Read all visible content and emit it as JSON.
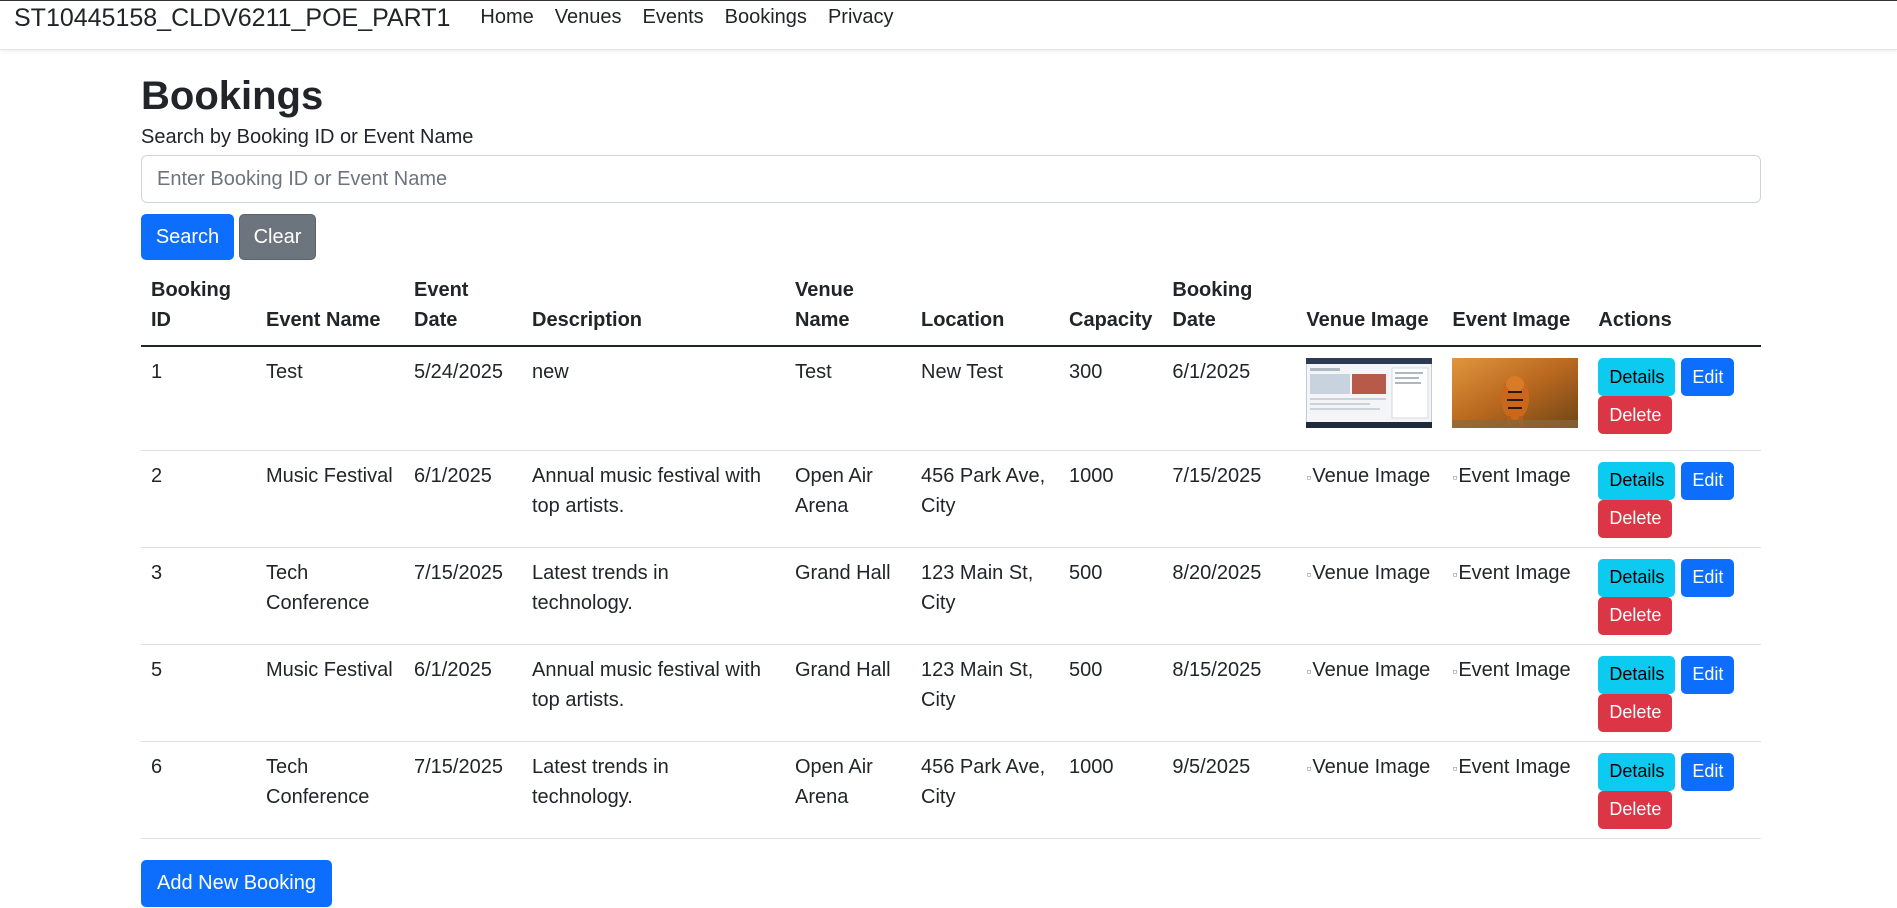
{
  "nav": {
    "brand": "ST10445158_CLDV6211_POE_PART1",
    "links": [
      "Home",
      "Venues",
      "Events",
      "Bookings",
      "Privacy"
    ]
  },
  "page": {
    "title": "Bookings",
    "search_label": "Search by Booking ID or Event Name",
    "search_placeholder": "Enter Booking ID or Event Name",
    "search_button": "Search",
    "clear_button": "Clear",
    "add_button": "Add New Booking"
  },
  "table": {
    "headers": {
      "booking_id": "Booking ID",
      "event_name": "Event Name",
      "event_date": "Event Date",
      "description": "Description",
      "venue_name": "Venue Name",
      "location": "Location",
      "capacity": "Capacity",
      "booking_date": "Booking Date",
      "venue_image": "Venue Image",
      "event_image": "Event Image",
      "actions": "Actions"
    },
    "actions": {
      "details": "Details",
      "edit": "Edit",
      "delete": "Delete"
    },
    "alt": {
      "venue": "Venue Image",
      "event": "Event Image"
    },
    "rows": [
      {
        "id": "1",
        "event": "Test",
        "event_date": "5/24/2025",
        "description": "new",
        "venue": "Test",
        "location": "New Test",
        "capacity": "300",
        "booking_date": "6/1/2025",
        "has_images": true
      },
      {
        "id": "2",
        "event": "Music Festival",
        "event_date": "6/1/2025",
        "description": "Annual music festival with top artists.",
        "venue": "Open Air Arena",
        "location": "456 Park Ave, City",
        "capacity": "1000",
        "booking_date": "7/15/2025",
        "has_images": false
      },
      {
        "id": "3",
        "event": "Tech Conference",
        "event_date": "7/15/2025",
        "description": "Latest trends in technology.",
        "venue": "Grand Hall",
        "location": "123 Main St, City",
        "capacity": "500",
        "booking_date": "8/20/2025",
        "has_images": false
      },
      {
        "id": "5",
        "event": "Music Festival",
        "event_date": "6/1/2025",
        "description": "Annual music festival with top artists.",
        "venue": "Grand Hall",
        "location": "123 Main St, City",
        "capacity": "500",
        "booking_date": "8/15/2025",
        "has_images": false
      },
      {
        "id": "6",
        "event": "Tech Conference",
        "event_date": "7/15/2025",
        "description": "Latest trends in technology.",
        "venue": "Open Air Arena",
        "location": "456 Park Ave, City",
        "capacity": "1000",
        "booking_date": "9/5/2025",
        "has_images": false
      }
    ]
  },
  "colors": {
    "primary": "#0d6efd",
    "secondary": "#6c757d",
    "info": "#0dcaf0",
    "danger": "#dc3545"
  }
}
